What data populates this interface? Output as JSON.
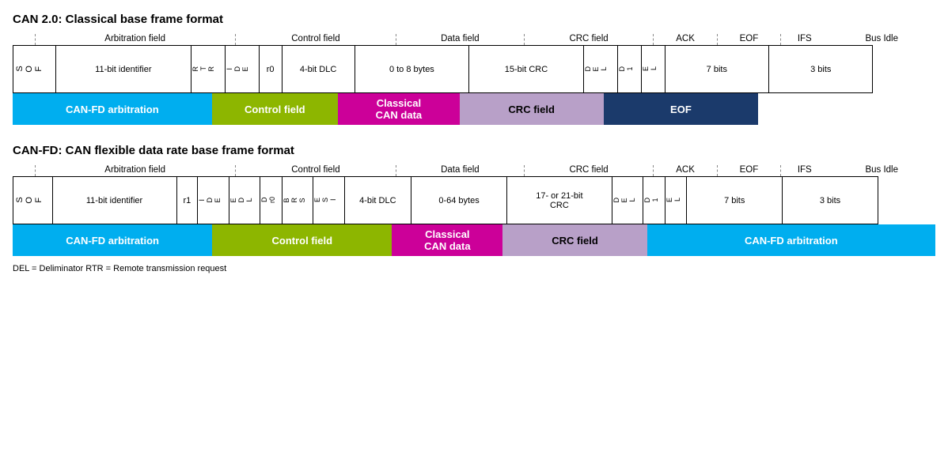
{
  "can20": {
    "title": "CAN 2.0: Classical base frame format",
    "headers": {
      "arbitration": "Arbitration field",
      "control": "Control field",
      "data": "Data field",
      "crc": "CRC field",
      "ack": "ACK",
      "eof": "EOF",
      "ifs": "IFS",
      "bus_idle": "Bus Idle"
    },
    "fields": {
      "sof": "S\nO\nF",
      "identifier": "11-bit identifier",
      "rtr": "R\nT\nR",
      "ide": "I\nD\nE",
      "r0": "r0",
      "dlc": "4-bit DLC",
      "data_bytes": "0 to 8 bytes",
      "crc": "15-bit CRC",
      "del1": "D\nE\nL",
      "ack_slot": "D\n1",
      "del2": "E\nL",
      "eof_bits": "7 bits",
      "ifs_bits": "3 bits"
    },
    "color_bars": {
      "arbitration": "CAN-FD arbitration",
      "control": "Control field",
      "data": "Classical\nCAN data",
      "crc": "CRC field",
      "eof": "EOF"
    }
  },
  "canfd": {
    "title": "CAN-FD: CAN flexible data rate base frame format",
    "headers": {
      "arbitration": "Arbitration field",
      "control": "Control field",
      "data": "Data field",
      "crc": "CRC field",
      "ack": "ACK",
      "eof": "EOF",
      "ifs": "IFS",
      "bus_idle": "Bus Idle"
    },
    "fields": {
      "sof": "S\nO\nF",
      "identifier": "11-bit identifier",
      "r1": "r1",
      "ide": "I\nD\nE",
      "edl": "E\nD\nL",
      "d0": "D\nr0",
      "brs": "B\nR\nS",
      "esi": "E\nS\nI",
      "dlc": "4-bit DLC",
      "data_bytes": "0-64 bytes",
      "crc": "17- or 21-bit\nCRC",
      "del1": "D\nE\nL",
      "ack_slot": "D\n1",
      "del2": "E\nL",
      "eof_bits": "7 bits",
      "ifs_bits": "3 bits"
    },
    "color_bars": {
      "arbitration": "CAN-FD arbitration",
      "control": "Control field",
      "data": "Classical\nCAN data",
      "crc": "CRC field",
      "eof": "CAN-FD arbitration"
    }
  },
  "footnote": "DEL = Deliminator     RTR = Remote transmission request"
}
